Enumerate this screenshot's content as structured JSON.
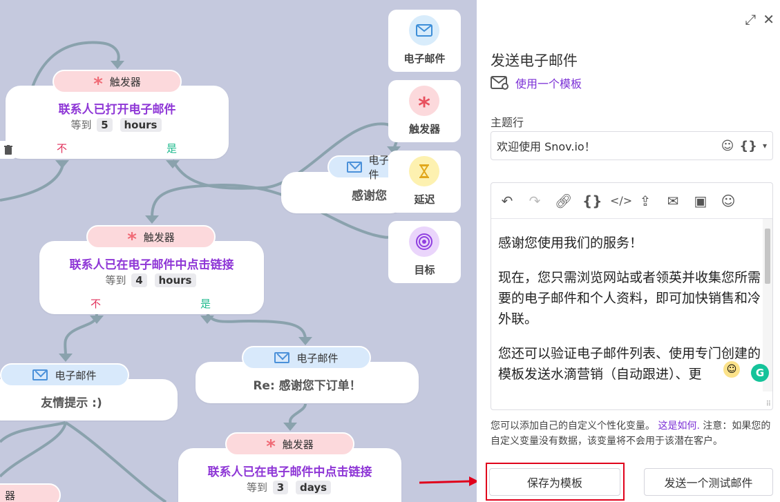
{
  "canvas": {
    "nodes": [
      {
        "tag": "触发器",
        "title": "联系人已打开电子邮件",
        "wait_prefix": "等到",
        "wait_num": "5",
        "wait_unit": "hours",
        "no": "不",
        "yes": "是"
      },
      {
        "tag": "触发器",
        "title": "联系人已在电子邮件中点击链接",
        "wait_prefix": "等到",
        "wait_num": "4",
        "wait_unit": "hours",
        "no": "不",
        "yes": "是"
      },
      {
        "tag": "电子邮件",
        "subject": "友情提示 :)"
      },
      {
        "tag": "电子邮件",
        "subject": "Re: 感谢您下订单！"
      },
      {
        "tag": "触发器",
        "title": "联系人已在电子邮件中点击链接",
        "wait_prefix": "等到",
        "wait_num": "3",
        "wait_unit": "days"
      },
      {
        "tag": "电子邮件",
        "subject": "感谢您"
      },
      {
        "tag": "器"
      }
    ],
    "palette": [
      {
        "label": "电子邮件",
        "icon": "envelope-icon",
        "color": "#d8ecfb"
      },
      {
        "label": "触发器",
        "icon": "asterisk-icon",
        "color": "#fcd9dc"
      },
      {
        "label": "延迟",
        "icon": "hourglass-icon",
        "color": "#fdf1b0"
      },
      {
        "label": "目标",
        "icon": "target-icon",
        "color": "#ead5fb"
      }
    ]
  },
  "panel": {
    "title": "发送电子邮件",
    "template_link": "使用一个模板",
    "subject_label": "主题行",
    "subject_value": "欢迎使用 Snov.io！",
    "body": [
      "感谢您使用我们的服务！",
      "现在，您只需浏览网站或者领英并收集您所需要的电子邮件和个人资料，即可加快销售和冷外联。",
      "您还可以验证电子邮件列表、使用专门创建的模板发送水滴营销（自动跟进）、更"
    ],
    "note_before": "您可以添加自己的自定义个性化变量。",
    "note_link": "这是如何.",
    "note_after": " 注意：如果您的自定义变量没有数据，该变量将不会用于该潜在客户。",
    "save_template": "保存为模板",
    "send_test": "发送一个测试邮件"
  },
  "colors": {
    "accent": "#7b2fd6",
    "highlight": "#e0001b",
    "canvas_bg": "#c5c9de"
  }
}
